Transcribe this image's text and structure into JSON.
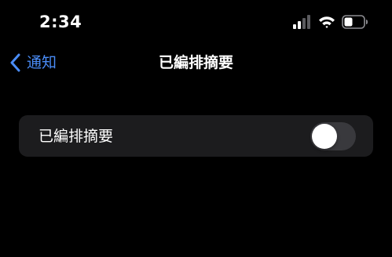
{
  "status_bar": {
    "time": "2:34",
    "icons": [
      "cellular-signal-icon",
      "wifi-icon",
      "battery-icon"
    ]
  },
  "nav": {
    "back_label": "通知",
    "title": "已編排摘要"
  },
  "settings": {
    "rows": [
      {
        "label": "已編排摘要",
        "toggle_on": false
      }
    ]
  },
  "colors": {
    "background": "#000000",
    "card": "#1c1c1e",
    "accent": "#4a8df8",
    "toggle_off": "#39393d"
  }
}
